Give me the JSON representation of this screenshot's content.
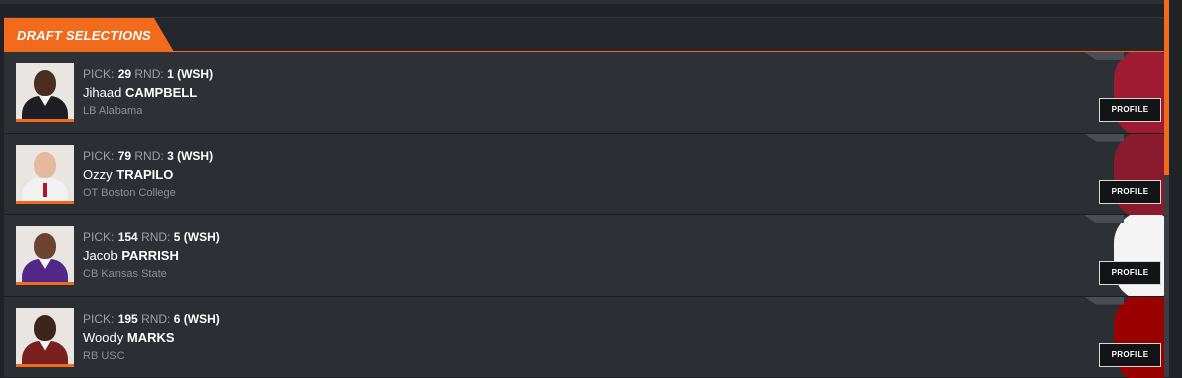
{
  "section": {
    "title": "DRAFT SELECTIONS"
  },
  "labels": {
    "pick": "PICK:",
    "round": "RND:",
    "profile": "PROFILE"
  },
  "picks": [
    {
      "pick": "29",
      "round": "1",
      "team": "(WSH)",
      "first": "Jihaad",
      "last": "CAMPBELL",
      "position_school": "LB Alabama",
      "photo": {
        "skin": "#4a2e22",
        "suit": "#1d1f24"
      },
      "logo_color": "#9e1b32"
    },
    {
      "pick": "79",
      "round": "3",
      "team": "(WSH)",
      "first": "Ozzy",
      "last": "TRAPILO",
      "position_school": "OT Boston College",
      "photo": {
        "skin": "#e4b9a0",
        "suit": "#f1f1f1"
      },
      "logo_color": "#8a1b2e"
    },
    {
      "pick": "154",
      "round": "5",
      "team": "(WSH)",
      "first": "Jacob",
      "last": "PARRISH",
      "position_school": "CB Kansas State",
      "photo": {
        "skin": "#6b4330",
        "suit": "#512888"
      },
      "logo_color": "#f4f4f4"
    },
    {
      "pick": "195",
      "round": "6",
      "team": "(WSH)",
      "first": "Woody",
      "last": "MARKS",
      "position_school": "RB USC",
      "photo": {
        "skin": "#3d251b",
        "suit": "#7a1f1f"
      },
      "logo_color": "#990000"
    }
  ]
}
